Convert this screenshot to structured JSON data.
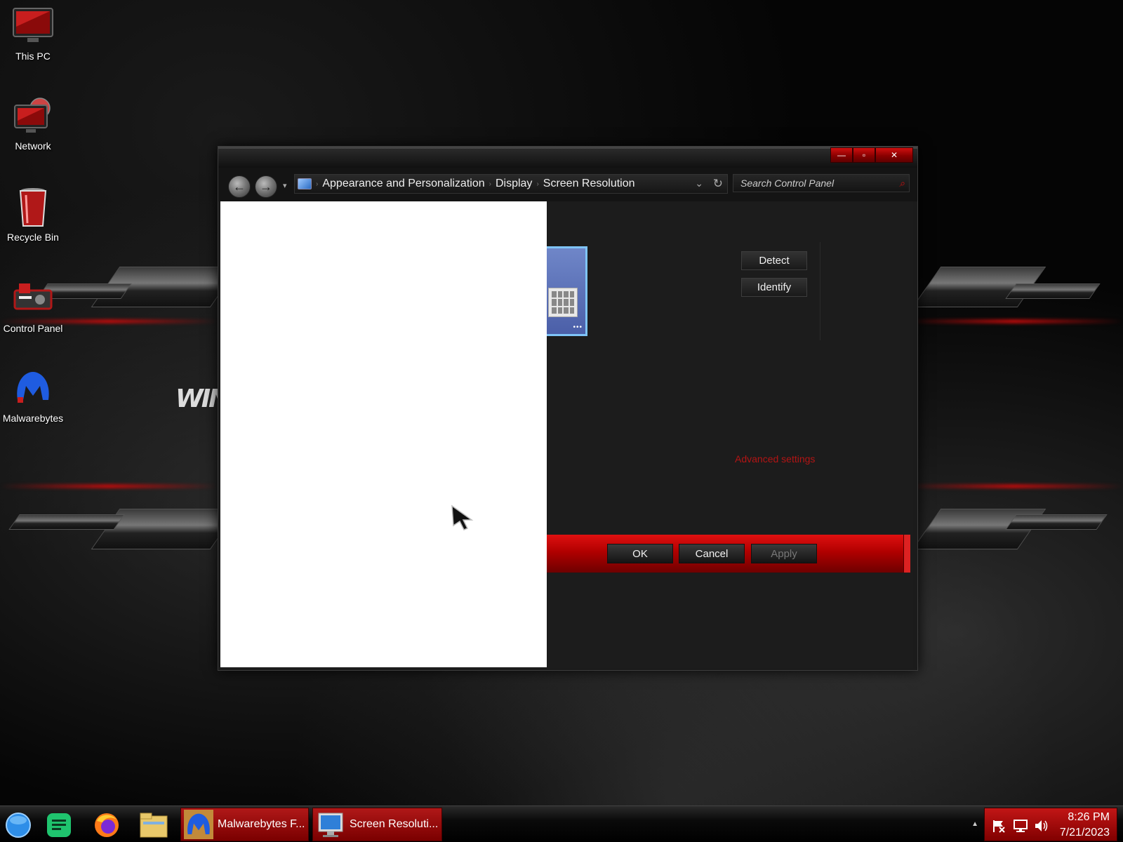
{
  "desktop": {
    "icons": [
      {
        "label": "This PC"
      },
      {
        "label": "Network"
      },
      {
        "label": "Recycle Bin"
      },
      {
        "label": "Control Panel"
      },
      {
        "label": "Malwarebytes"
      }
    ],
    "wallpaper_text": "WIN"
  },
  "window": {
    "controls": {
      "minimize": "—",
      "maximize": "▫",
      "close": "✕"
    },
    "nav": {
      "back_icon": "←",
      "forward_icon": "→",
      "dropdown_icon": "▾"
    },
    "breadcrumb": [
      "Appearance and Personalization",
      "Display",
      "Screen Resolution"
    ],
    "address_chevron": "⌄",
    "refresh_icon": "↻",
    "search": {
      "placeholder": "Search Control Panel",
      "icon": "⌕"
    },
    "side_buttons": {
      "detect": "Detect",
      "identify": "Identify"
    },
    "advanced_link": "Advanced settings",
    "actions": {
      "ok": "OK",
      "cancel": "Cancel",
      "apply": "Apply"
    }
  },
  "taskbar": {
    "apps": [
      {
        "label": "Malwarebytes F..."
      },
      {
        "label": "Screen Resoluti..."
      }
    ],
    "tray_expand": "▲",
    "clock": {
      "time": "8:26 PM",
      "date": "7/21/2023"
    }
  },
  "colors": {
    "accent_red": "#b00000",
    "link_red": "#b31414",
    "window_bg": "#1c1c1c"
  }
}
